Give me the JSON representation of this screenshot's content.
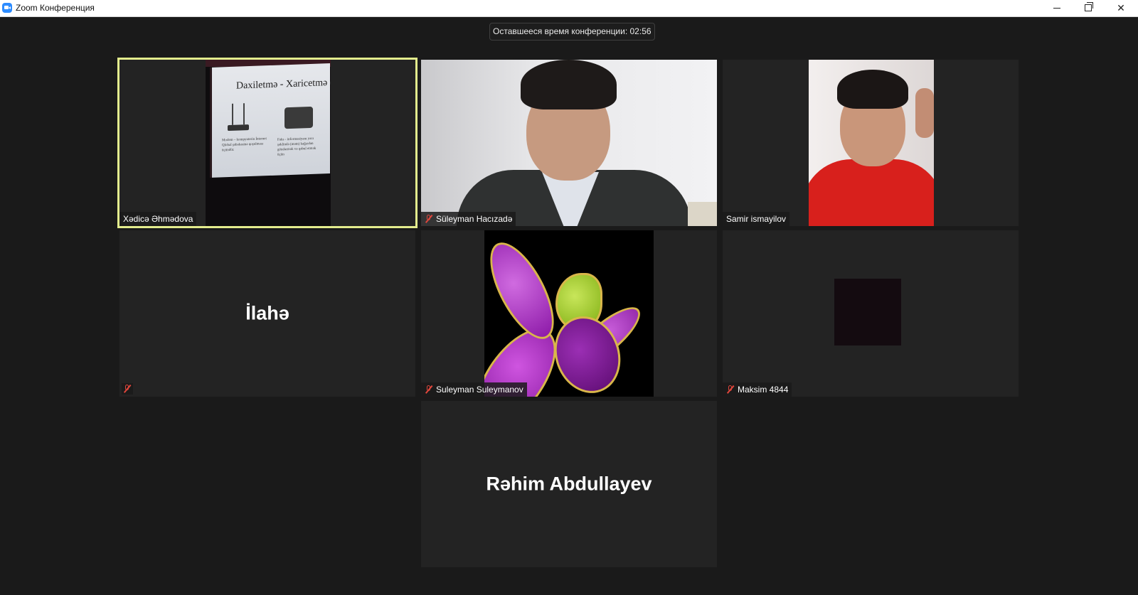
{
  "window": {
    "title": "Zoom Конференция",
    "buttons": {
      "minimize": "minimize",
      "maximize": "maximize",
      "close": "✕"
    }
  },
  "meeting": {
    "remaining_time_label": "Оставшееся время конференции: 02:56"
  },
  "slide": {
    "title": "Daxiletmə - Xaricetmə q",
    "text_left": "Modem – kompyuterin İnternet Qlobal şəbəkəsinə qoşulması üçündür.",
    "text_right": "Faks - informasiyanı yazı şəklində (mətn) kağızdan göndərmək və qəbul etmək üçün"
  },
  "participants": [
    {
      "name": "Xədicə Əhmədova",
      "muted": false,
      "active_speaker": true,
      "video": "slide"
    },
    {
      "name": "Süleyman Hacızadə",
      "muted": true,
      "active_speaker": false,
      "video": "person"
    },
    {
      "name": "Samir ismayilov",
      "muted": false,
      "active_speaker": false,
      "video": "person"
    },
    {
      "name": "İlahə",
      "muted": true,
      "active_speaker": false,
      "video": "none"
    },
    {
      "name": "Suleyman Suleymanov",
      "muted": true,
      "active_speaker": false,
      "video": "avatar-flower"
    },
    {
      "name": "Maksim 4844",
      "muted": true,
      "active_speaker": false,
      "video": "dark"
    },
    {
      "name": "Rəhim Abdullayev",
      "muted": false,
      "active_speaker": false,
      "video": "none"
    }
  ],
  "colors": {
    "background": "#1a1a1a",
    "tile": "#232323",
    "active_speaker_border": "#e3ec8d",
    "mute_icon": "#e0463c",
    "zoom_blue": "#2d8cff"
  }
}
